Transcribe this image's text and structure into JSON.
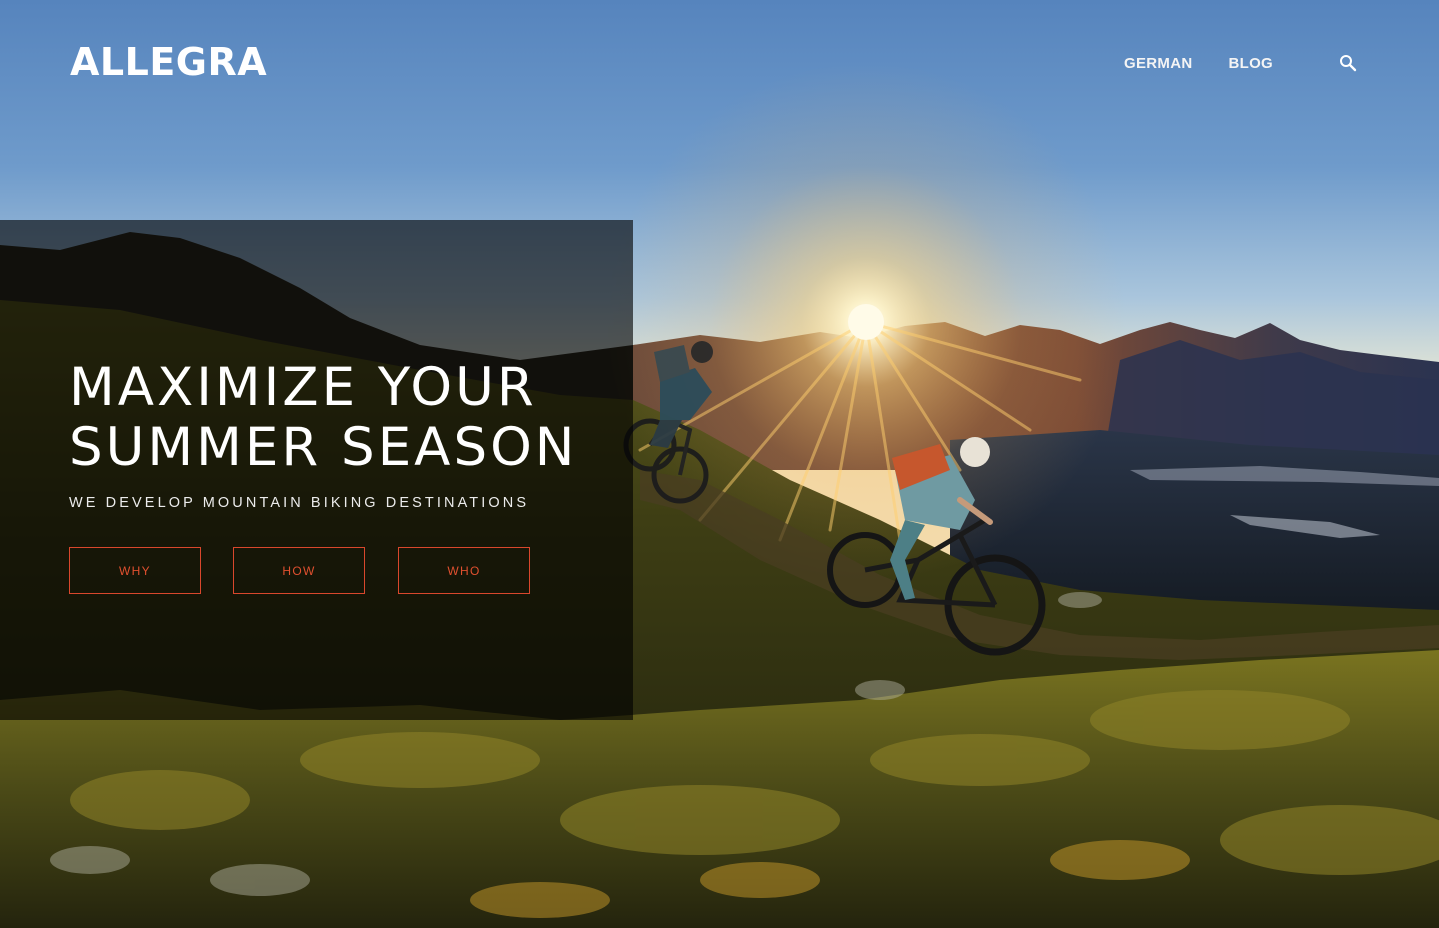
{
  "site": {
    "logo": "ALLEGRA"
  },
  "nav": {
    "items": [
      {
        "label": "GERMAN"
      },
      {
        "label": "BLOG"
      }
    ],
    "search_icon": "search-icon"
  },
  "hero": {
    "headline_line1": "MAXIMIZE YOUR",
    "headline_line2": "SUMMER SEASON",
    "tagline": "WE DEVELOP MOUNTAIN BIKING DESTINATIONS",
    "buttons": [
      {
        "label": "WHY"
      },
      {
        "label": "HOW"
      },
      {
        "label": "WHO"
      }
    ]
  },
  "colors": {
    "accent": "#d9472c",
    "text": "#ffffff",
    "sky_top": "#5684bd",
    "sun": "#ffd27a"
  }
}
